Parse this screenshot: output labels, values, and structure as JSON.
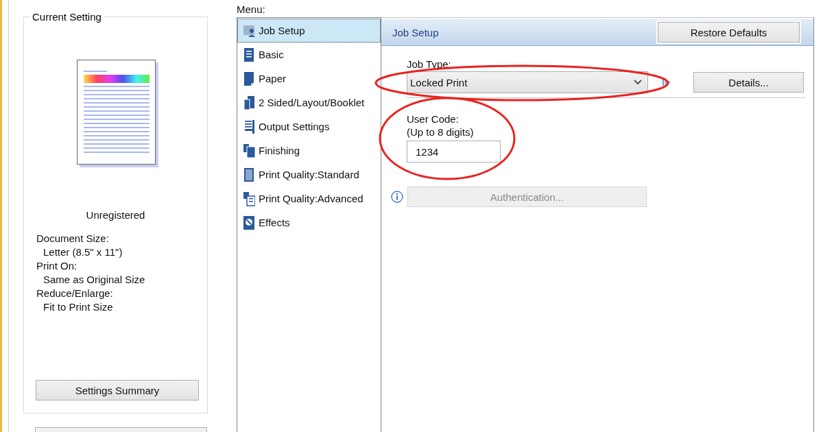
{
  "current_setting": {
    "title": "Current Setting",
    "status": "Unregistered",
    "details": [
      {
        "label": "Document Size:",
        "value": "Letter (8.5\" x 11\")"
      },
      {
        "label": "Print On:",
        "value": "Same as Original Size"
      },
      {
        "label": "Reduce/Enlarge:",
        "value": "Fit to Print Size"
      }
    ],
    "button": "Settings Summary"
  },
  "menu": {
    "label": "Menu:",
    "items": [
      {
        "label": "Job Setup",
        "kind": "job",
        "selected": true
      },
      {
        "label": "Basic",
        "kind": "basic",
        "selected": false
      },
      {
        "label": "Paper",
        "kind": "paper",
        "selected": false
      },
      {
        "label": "2 Sided/Layout/Booklet",
        "kind": "layout",
        "selected": false
      },
      {
        "label": "Output Settings",
        "kind": "output",
        "selected": false
      },
      {
        "label": "Finishing",
        "kind": "finishing",
        "selected": false
      },
      {
        "label": "Print Quality:Standard",
        "kind": "quality",
        "selected": false
      },
      {
        "label": "Print Quality:Advanced",
        "kind": "advanced",
        "selected": false
      },
      {
        "label": "Effects",
        "kind": "effects",
        "selected": false
      }
    ]
  },
  "panel": {
    "title": "Job Setup",
    "restore_button": "Restore Defaults",
    "job_type": {
      "label": "Job Type:",
      "value": "Locked Print"
    },
    "details_button": "Details...",
    "user_code": {
      "label": "User Code:",
      "hint": "(Up to 8 digits)",
      "value": "1234"
    },
    "authentication_button": {
      "label": "Authentication...",
      "disabled": true
    }
  }
}
